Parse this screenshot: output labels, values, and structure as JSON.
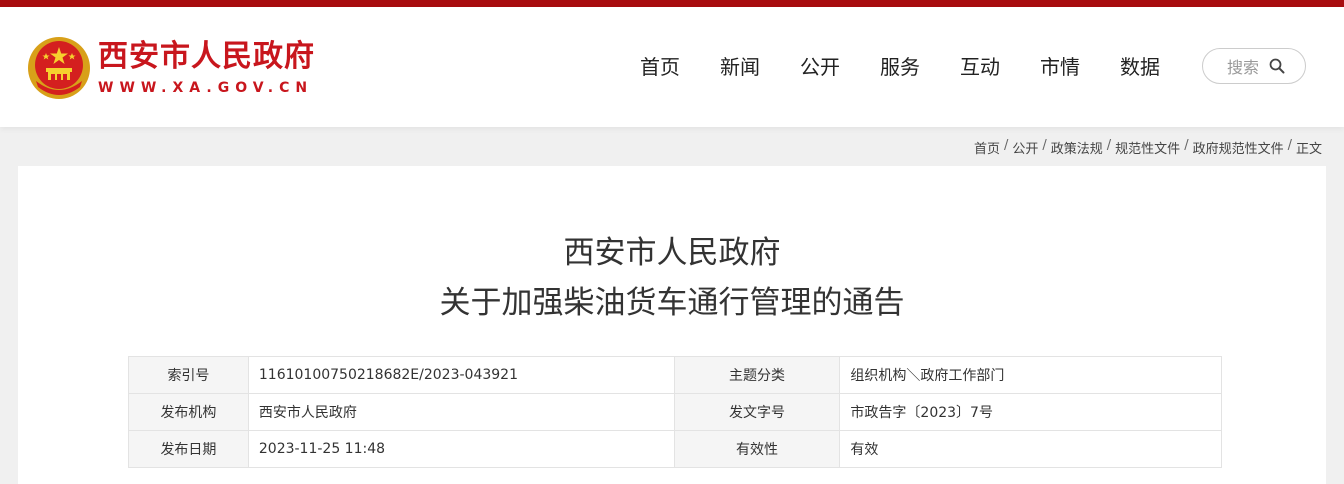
{
  "site": {
    "name": "西安市人民政府",
    "url": "WWW.XA.GOV.CN",
    "brand_color": "#c8161d",
    "top_bar_color": "#a80c0f"
  },
  "nav": {
    "items": [
      {
        "label": "首页"
      },
      {
        "label": "新闻"
      },
      {
        "label": "公开"
      },
      {
        "label": "服务"
      },
      {
        "label": "互动"
      },
      {
        "label": "市情"
      },
      {
        "label": "数据"
      }
    ]
  },
  "search": {
    "label": "搜索",
    "icon": "search-icon"
  },
  "breadcrumb": {
    "items": [
      "首页",
      "公开",
      "政策法规",
      "规范性文件",
      "政府规范性文件",
      "正文"
    ],
    "separator": "/"
  },
  "document": {
    "title_line1": "西安市人民政府",
    "title_line2": "关于加强柴油货车通行管理的通告"
  },
  "meta": {
    "rows": [
      {
        "k1": "索引号",
        "v1": "11610100750218682E/2023-043921",
        "k2": "主题分类",
        "v2": "组织机构＼政府工作部门"
      },
      {
        "k1": "发布机构",
        "v1": "西安市人民政府",
        "k2": "发文字号",
        "v2": "市政告字〔2023〕7号"
      },
      {
        "k1": "发布日期",
        "v1": "2023-11-25 11:48",
        "k2": "有效性",
        "v2": "有效"
      }
    ]
  }
}
